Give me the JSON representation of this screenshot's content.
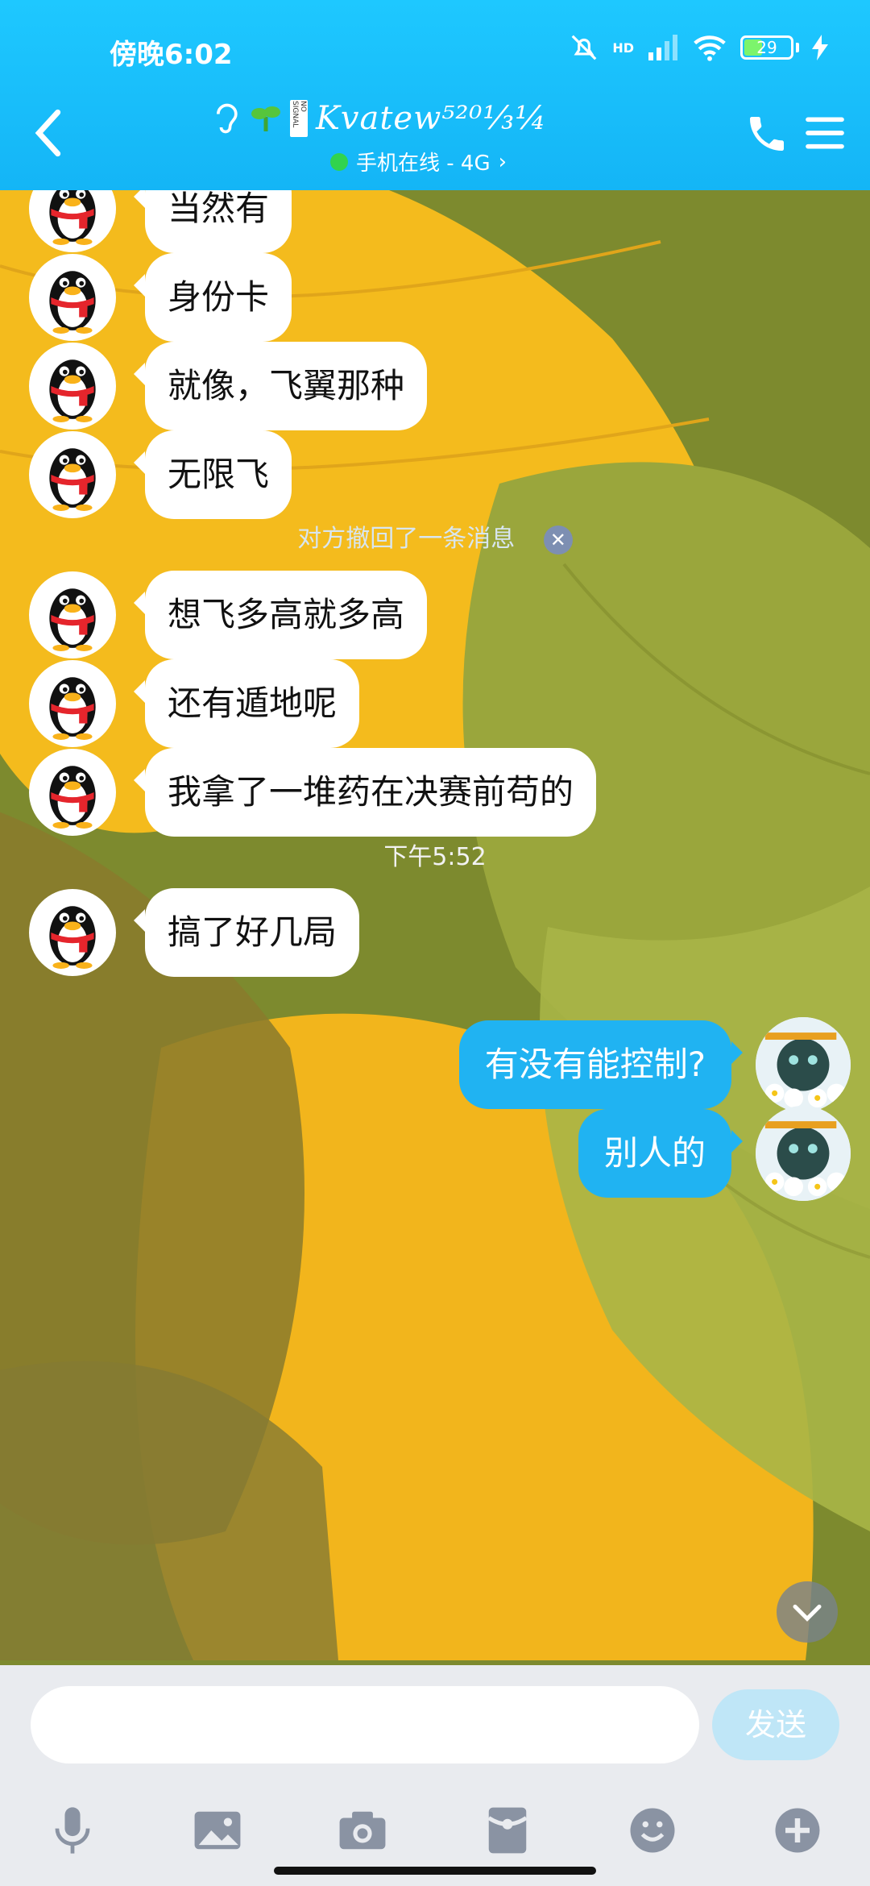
{
  "status": {
    "time": "傍晚6:02",
    "battery": "29",
    "network": "HD"
  },
  "header": {
    "title": "Kvatew⁵²⁰⅓¼",
    "subtitle": "手机在线 - 4G",
    "badge": "NO SIGNAL"
  },
  "messages": [
    {
      "side": "in",
      "text": "当然有"
    },
    {
      "side": "in",
      "text": "身份卡"
    },
    {
      "side": "in",
      "text": "就像，飞翼那种"
    },
    {
      "side": "in",
      "text": "无限飞"
    },
    {
      "side": "in",
      "text": "想飞多高就多高"
    },
    {
      "side": "in",
      "text": "还有遁地呢"
    },
    {
      "side": "in",
      "text": "我拿了一堆药在决赛前苟的"
    },
    {
      "side": "in",
      "text": "搞了好几局"
    },
    {
      "side": "out",
      "text": "有没有能控制?"
    },
    {
      "side": "out",
      "text": "别人的"
    }
  ],
  "notices": {
    "recalled": "对方撤回了一条消息",
    "time_separator": "下午5:52"
  },
  "composer": {
    "placeholder": "",
    "send_label": "发送"
  },
  "toolbar": [
    "mic-icon",
    "image-icon",
    "camera-icon",
    "red-packet-icon",
    "emoji-icon",
    "plus-icon"
  ],
  "colors": {
    "header": "#1ec8ff",
    "out_bubble": "#20b3f2",
    "in_bubble": "#ffffff"
  }
}
